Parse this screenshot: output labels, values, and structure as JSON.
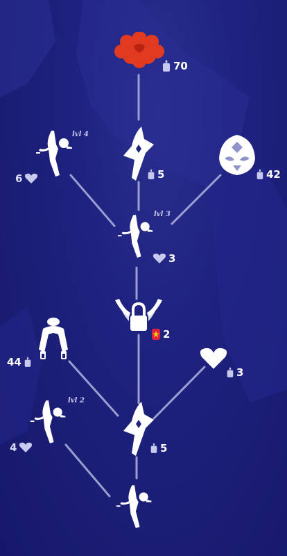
{
  "colors": {
    "background": "#1f2280",
    "line": "#a9acd9",
    "icon": "#ffffff",
    "heart": "#c7c9ee",
    "candle": "#c7c9ee",
    "accent_red": "#e23a20",
    "ticket_red": "#e0223a",
    "ticket_star": "#f5c518"
  },
  "nodes": {
    "cape_top": {
      "icon": "red-cape-icon",
      "cost": "70",
      "currency": "candle-icon"
    },
    "emote_lvl4": {
      "icon": "emote-pose-icon",
      "level": "lvl 4",
      "cost": "6",
      "currency": "heart-icon"
    },
    "spark_top": {
      "icon": "spirit-spark-icon",
      "cost": "5",
      "currency": "candle-icon"
    },
    "mask": {
      "icon": "mask-icon",
      "cost": "42",
      "currency": "candle-icon"
    },
    "emote_lvl3": {
      "icon": "emote-pose-icon",
      "level": "lvl 3",
      "cost": "3",
      "currency": "heart-icon"
    },
    "wing_lock": {
      "icon": "winged-lock-icon",
      "cost": "2",
      "currency": "season-ticket-icon"
    },
    "hair": {
      "icon": "hairstyle-icon",
      "cost": "44",
      "currency": "candle-icon"
    },
    "heart": {
      "icon": "heart-gift-icon",
      "cost": "3",
      "currency": "candle-icon"
    },
    "emote_lvl2": {
      "icon": "emote-pose-icon",
      "level": "lvl 2",
      "cost": "4",
      "currency": "heart-icon"
    },
    "spark_bottom": {
      "icon": "spirit-spark-icon",
      "cost": "5",
      "currency": "candle-icon"
    },
    "emote_base": {
      "icon": "emote-pose-icon"
    }
  }
}
